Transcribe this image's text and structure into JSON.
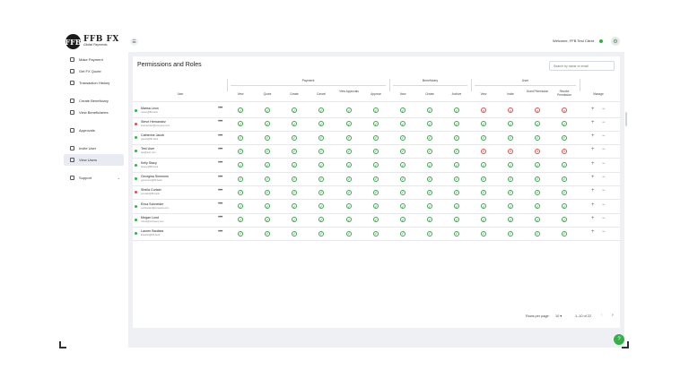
{
  "brand": {
    "logo_mark": "FFB",
    "name": "FFB FX",
    "subtitle": "Global Payments"
  },
  "sidebar": {
    "items": [
      {
        "label": "Make Payment",
        "icon": "payment-icon"
      },
      {
        "label": "Get FX Quote",
        "icon": "quote-icon"
      },
      {
        "label": "Transaction History",
        "icon": "history-icon"
      },
      {
        "label": "Create Beneficiary",
        "icon": "add-beneficiary-icon"
      },
      {
        "label": "View Beneficiaries",
        "icon": "beneficiaries-icon"
      },
      {
        "label": "Approvals",
        "icon": "approvals-icon"
      },
      {
        "label": "Invite User",
        "icon": "invite-user-icon"
      },
      {
        "label": "View Users",
        "icon": "users-icon",
        "active": true
      },
      {
        "label": "Support",
        "icon": "support-icon"
      }
    ]
  },
  "header": {
    "welcome": "Welcome, FFB Test Client",
    "status_color": "#34b04a"
  },
  "page": {
    "title": "Permissions and Roles",
    "search_placeholder": "Search by name or email"
  },
  "table": {
    "user_header": "User",
    "groups": [
      "Payment",
      "Beneficiary",
      "User"
    ],
    "columns": [
      "View",
      "Quote",
      "Create",
      "Cancel",
      "View Approvals",
      "Approve",
      "View",
      "Create",
      "Archive",
      "View",
      "Invite",
      "Grant Permission",
      "Revoke Permission",
      "Manage"
    ],
    "rows": [
      {
        "name": "Marisa Leon",
        "email": "mleon@ffb.bank",
        "status": "#34b04a",
        "perms": [
          1,
          1,
          1,
          1,
          1,
          1,
          1,
          1,
          1,
          0,
          0,
          0,
          0
        ]
      },
      {
        "name": "Steve Hernandez",
        "email": "shernandez@company.com",
        "status": "#d9534f",
        "perms": [
          1,
          1,
          1,
          1,
          1,
          1,
          1,
          1,
          1,
          1,
          1,
          1,
          1
        ]
      },
      {
        "name": "Catherine Jacob",
        "email": "cjacob@ffb.bank",
        "status": "#34b04a",
        "perms": [
          1,
          1,
          1,
          1,
          1,
          1,
          1,
          1,
          1,
          1,
          1,
          1,
          1
        ]
      },
      {
        "name": "Test User",
        "email": "test@test.com",
        "status": "#34b04a",
        "perms": [
          1,
          1,
          1,
          1,
          1,
          1,
          1,
          1,
          1,
          0,
          0,
          0,
          0
        ]
      },
      {
        "name": "Kelly Stacy",
        "email": "kstacy@ffb.bank",
        "status": "#34b04a",
        "perms": [
          1,
          1,
          1,
          1,
          1,
          1,
          1,
          1,
          1,
          1,
          1,
          1,
          1
        ]
      },
      {
        "name": "Georgina Simmons",
        "email": "gsimmons@ffb.bank",
        "status": "#34b04a",
        "perms": [
          1,
          1,
          1,
          1,
          1,
          1,
          1,
          1,
          1,
          1,
          1,
          1,
          1
        ]
      },
      {
        "name": "Sheila Curtain",
        "email": "scurtain@ffb.bank",
        "status": "#d9534f",
        "perms": [
          1,
          1,
          1,
          1,
          1,
          1,
          1,
          1,
          1,
          1,
          1,
          1,
          1
        ]
      },
      {
        "name": "Erica Schneider",
        "email": "eschneider@company.com",
        "status": "#34b04a",
        "perms": [
          1,
          1,
          1,
          1,
          1,
          1,
          1,
          1,
          1,
          1,
          1,
          1,
          1
        ]
      },
      {
        "name": "Megan Lund",
        "email": "mlund@ocmpany.com",
        "status": "#34b04a",
        "perms": [
          1,
          1,
          1,
          1,
          1,
          1,
          1,
          1,
          1,
          1,
          1,
          1,
          1
        ]
      },
      {
        "name": "Lauren Bautista",
        "email": "lbautista@ffb.bank",
        "status": "#34b04a",
        "perms": [
          1,
          1,
          1,
          1,
          1,
          1,
          1,
          1,
          1,
          1,
          1,
          1,
          1
        ]
      }
    ]
  },
  "pagination": {
    "rows_label": "Rows per page:",
    "rows_value": "10 ▾",
    "range": "1–10 of 22"
  },
  "colors": {
    "ok": "#3aa84e",
    "denied": "#d9534f",
    "accent": "#34b04a"
  }
}
